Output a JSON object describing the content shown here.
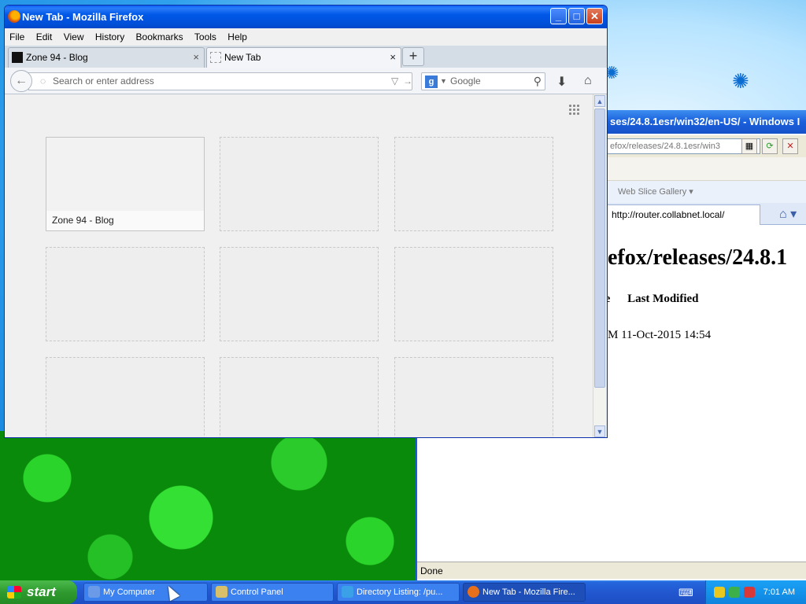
{
  "ie_window": {
    "title": "ses/24.8.1esr/win32/en-US/ - Windows I",
    "address": "efox/releases/24.8.1esr/win3",
    "fav_item": "Web Slice Gallery",
    "tab_url": "http://router.collabnet.local/",
    "heading": "efox/releases/24.8.1",
    "col_size": "ze",
    "col_modified": "Last Modified",
    "row": "M 11-Oct-2015 14:54",
    "status": "Done"
  },
  "firefox": {
    "title": "New Tab - Mozilla Firefox",
    "menu": [
      "File",
      "Edit",
      "View",
      "History",
      "Bookmarks",
      "Tools",
      "Help"
    ],
    "tabs": [
      {
        "label": "Zone 94 - Blog"
      },
      {
        "label": "New Tab"
      }
    ],
    "address_placeholder": "Search or enter address",
    "search_engine": "Google",
    "tiles": [
      {
        "caption": "Zone 94 - Blog"
      },
      {
        "caption": ""
      },
      {
        "caption": ""
      },
      {
        "caption": ""
      },
      {
        "caption": ""
      },
      {
        "caption": ""
      },
      {
        "caption": ""
      },
      {
        "caption": ""
      },
      {
        "caption": ""
      }
    ]
  },
  "taskbar": {
    "start": "start",
    "tasks": [
      {
        "label": "My Computer",
        "color": "#6a9ae8"
      },
      {
        "label": "Control Panel",
        "color": "#d8c06a"
      },
      {
        "label": "Directory Listing: /pu...",
        "color": "#3aa0e8"
      },
      {
        "label": "New Tab - Mozilla Fire...",
        "color": "#e8701a"
      }
    ],
    "clock": "7:01 AM"
  }
}
